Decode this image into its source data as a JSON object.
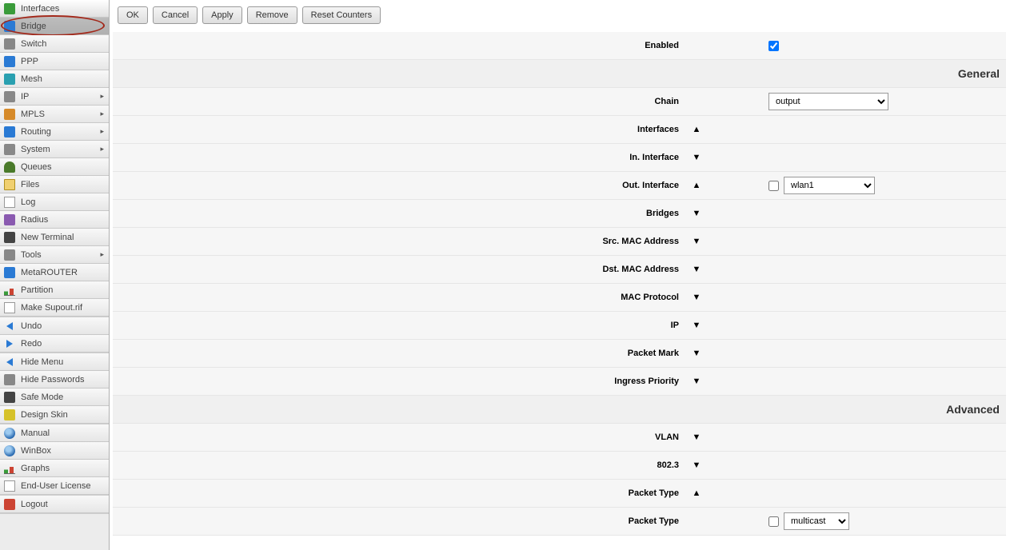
{
  "sidebar": {
    "items": [
      {
        "label": "Interfaces",
        "icon": "ic-green",
        "arrow": false
      },
      {
        "label": "Bridge",
        "icon": "ic-blue",
        "arrow": false,
        "selected": true,
        "highlight": true
      },
      {
        "label": "Switch",
        "icon": "ic-gray",
        "arrow": false
      },
      {
        "label": "PPP",
        "icon": "ic-blue",
        "arrow": false
      },
      {
        "label": "Mesh",
        "icon": "ic-cyan",
        "arrow": false
      },
      {
        "label": "IP",
        "icon": "ic-gray",
        "arrow": true
      },
      {
        "label": "MPLS",
        "icon": "ic-orange",
        "arrow": true
      },
      {
        "label": "Routing",
        "icon": "ic-blue",
        "arrow": true
      },
      {
        "label": "System",
        "icon": "ic-gray",
        "arrow": true
      },
      {
        "label": "Queues",
        "icon": "ic-tree",
        "arrow": false
      },
      {
        "label": "Files",
        "icon": "ic-folder",
        "arrow": false
      },
      {
        "label": "Log",
        "icon": "ic-file",
        "arrow": false
      },
      {
        "label": "Radius",
        "icon": "ic-purple",
        "arrow": false
      },
      {
        "label": "New Terminal",
        "icon": "ic-dark",
        "arrow": false
      },
      {
        "label": "Tools",
        "icon": "ic-gray",
        "arrow": true
      },
      {
        "label": "MetaROUTER",
        "icon": "ic-blue",
        "arrow": false
      },
      {
        "label": "Partition",
        "icon": "ic-chart",
        "arrow": false
      },
      {
        "label": "Make Supout.rif",
        "icon": "ic-file",
        "arrow": false
      }
    ],
    "group2": [
      {
        "label": "Undo",
        "icon": "ic-arrow-l"
      },
      {
        "label": "Redo",
        "icon": "ic-arrow-r"
      }
    ],
    "group3": [
      {
        "label": "Hide Menu",
        "icon": "ic-arrow-l"
      },
      {
        "label": "Hide Passwords",
        "icon": "ic-gray"
      },
      {
        "label": "Safe Mode",
        "icon": "ic-dark"
      },
      {
        "label": "Design Skin",
        "icon": "ic-yellow"
      }
    ],
    "group4": [
      {
        "label": "Manual",
        "icon": "ic-globe"
      },
      {
        "label": "WinBox",
        "icon": "ic-globe"
      },
      {
        "label": "Graphs",
        "icon": "ic-chart"
      },
      {
        "label": "End-User License",
        "icon": "ic-file"
      }
    ],
    "group5": [
      {
        "label": "Logout",
        "icon": "ic-red"
      }
    ]
  },
  "toolbar": {
    "ok": "OK",
    "cancel": "Cancel",
    "apply": "Apply",
    "remove": "Remove",
    "reset": "Reset Counters"
  },
  "form": {
    "enabled_label": "Enabled",
    "enabled_checked": true,
    "sections": {
      "general": "General",
      "advanced": "Advanced"
    },
    "chain_label": "Chain",
    "chain_value": "output",
    "interfaces_label": "Interfaces",
    "in_interface_label": "In. Interface",
    "out_interface_label": "Out. Interface",
    "out_interface_value": "wlan1",
    "bridges_label": "Bridges",
    "src_mac_label": "Src. MAC Address",
    "dst_mac_label": "Dst. MAC Address",
    "mac_protocol_label": "MAC Protocol",
    "ip_label": "IP",
    "packet_mark_label": "Packet Mark",
    "ingress_priority_label": "Ingress Priority",
    "vlan_label": "VLAN",
    "8023_label": "802.3",
    "packet_type_hdr": "Packet Type",
    "packet_type_label": "Packet Type",
    "packet_type_value": "multicast"
  },
  "glyph": {
    "up": "▲",
    "down": "▼",
    "right": "▸"
  }
}
